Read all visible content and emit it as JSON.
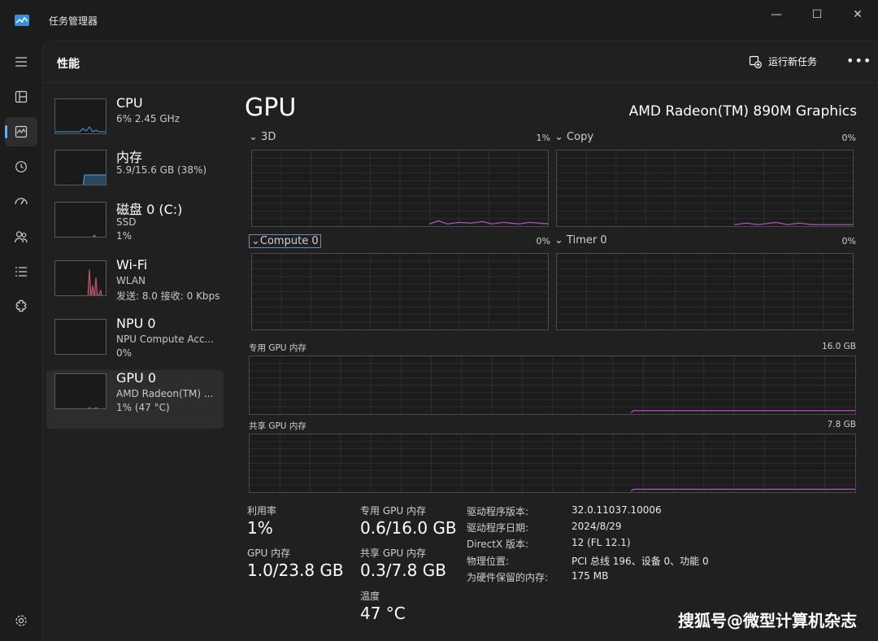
{
  "window": {
    "title": "任务管理器",
    "controls": {
      "minimize": "—",
      "maximize": "☐",
      "close": "✕"
    }
  },
  "header": {
    "page_title": "性能",
    "run_task_label": "运行新任务",
    "more_label": "•••"
  },
  "rail": {
    "items": [
      {
        "icon": "hamburger-menu-icon",
        "active": false
      },
      {
        "icon": "processes-icon",
        "active": false
      },
      {
        "icon": "performance-icon",
        "active": true
      },
      {
        "icon": "app-history-icon",
        "active": false
      },
      {
        "icon": "startup-apps-icon",
        "active": false
      },
      {
        "icon": "users-icon",
        "active": false
      },
      {
        "icon": "details-icon",
        "active": false
      },
      {
        "icon": "services-icon",
        "active": false
      },
      {
        "icon": "settings-icon",
        "active": false
      }
    ]
  },
  "perf_list": [
    {
      "name": "CPU",
      "line1": "6% 2.45 GHz",
      "line2": "",
      "color": "#4aa3df",
      "active": false
    },
    {
      "name": "内存",
      "line1": "5.9/15.6 GB (38%)",
      "line2": "",
      "color": "#4aa3df",
      "active": false
    },
    {
      "name": "磁盘 0 (C:)",
      "line1": "SSD",
      "line2": "1%",
      "color": "#8fb84a",
      "active": false
    },
    {
      "name": "Wi-Fi",
      "line1": "WLAN",
      "line2": "发送: 8.0 接收: 0 Kbps",
      "color": "#d05a7a",
      "active": false
    },
    {
      "name": "NPU 0",
      "line1": "NPU Compute Acc...",
      "line2": "0%",
      "color": "#4aa3df",
      "active": false
    },
    {
      "name": "GPU 0",
      "line1": "AMD Radeon(TM) ...",
      "line2": "1% (47 °C)",
      "color": "#b04fc4",
      "active": true
    }
  ],
  "gpu": {
    "title": "GPU",
    "model": "AMD Radeon(TM) 890M Graphics",
    "accent_color": "#b04fc4",
    "engines": [
      {
        "label": "3D",
        "percent": "1%"
      },
      {
        "label": "Copy",
        "percent": "0%"
      },
      {
        "label": "Compute 0",
        "percent": "0%"
      },
      {
        "label": "Timer 0",
        "percent": "0%"
      }
    ],
    "dedicated_mem": {
      "label": "专用 GPU 内存",
      "max": "16.0 GB"
    },
    "shared_mem": {
      "label": "共享 GPU 内存",
      "max": "7.8 GB"
    }
  },
  "stats": {
    "utilization": {
      "label": "利用率",
      "value": "1%"
    },
    "dedicated": {
      "label": "专用 GPU 内存",
      "value": "0.6/16.0 GB"
    },
    "gpu_mem": {
      "label": "GPU 内存",
      "value": "1.0/23.8 GB"
    },
    "shared": {
      "label": "共享 GPU 内存",
      "value": "0.3/7.8 GB"
    },
    "temp": {
      "label": "温度",
      "value": "47 °C"
    }
  },
  "info": [
    {
      "key": "驱动程序版本:",
      "value": "32.0.11037.10006"
    },
    {
      "key": "驱动程序日期:",
      "value": "2024/8/29"
    },
    {
      "key": "DirectX 版本:",
      "value": "12 (FL 12.1)"
    },
    {
      "key": "物理位置:",
      "value": "PCI 总线 196、设备 0、功能 0"
    },
    {
      "key": "为硬件保留的内存:",
      "value": "175 MB"
    }
  ],
  "watermark": "搜狐号@微型计算机杂志"
}
